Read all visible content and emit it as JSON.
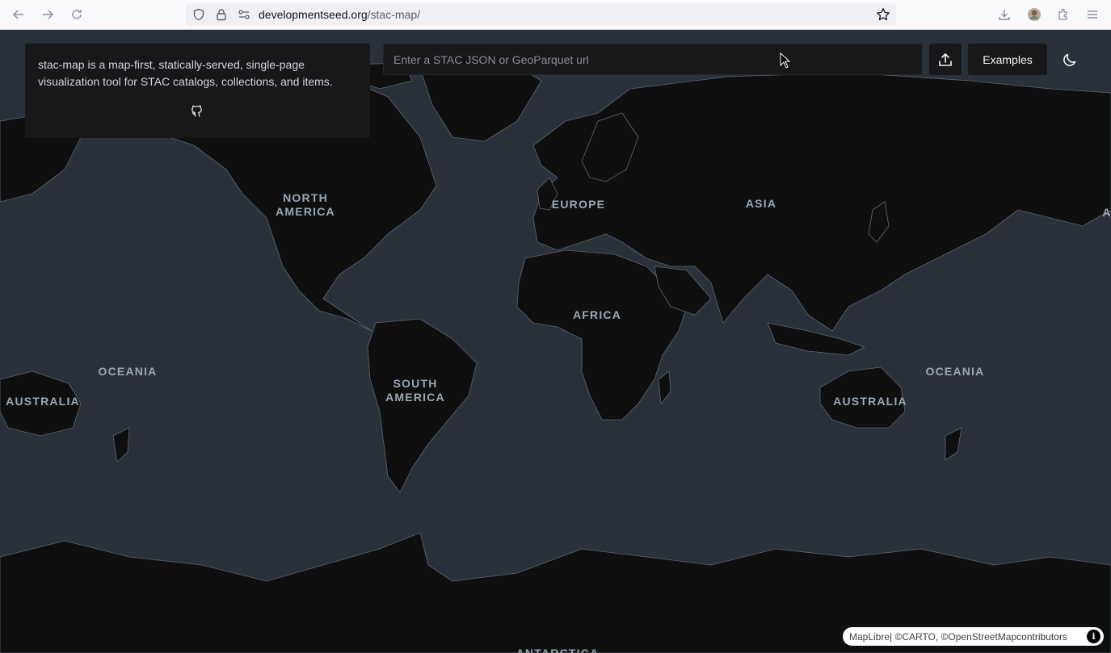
{
  "browser": {
    "url_domain": "developmentseed.org",
    "url_path": "/stac-map/",
    "icons": [
      "back-icon",
      "forward-icon",
      "reload-icon",
      "shield-icon",
      "lock-icon",
      "permissions-icon",
      "bookmark-star-icon",
      "download-icon",
      "profile-avatar-icon",
      "extensions-icon",
      "menu-icon"
    ]
  },
  "info_panel": {
    "description": "stac-map is a map-first, statically-served, single-page visualization tool for STAC catalogs, collections, and items."
  },
  "search": {
    "placeholder": "Enter a STAC JSON or GeoParquet url",
    "value": ""
  },
  "toolbar": {
    "examples_label": "Examples"
  },
  "map": {
    "labels": {
      "north_america": "NORTH AMERICA",
      "europe": "EUROPE",
      "asia": "ASIA",
      "asia_edge": "A",
      "africa": "AFRICA",
      "south_america": "SOUTH AMERICA",
      "oceania_left": "OCEANIA",
      "oceania_right": "OCEANIA",
      "australia_left": "AUSTRALIA",
      "australia_right": "AUSTRALIA",
      "antarctica": "ANTARCTICA"
    },
    "colors": {
      "water": "#2b313a",
      "land": "#0f0f10",
      "borders": "#5c6570"
    }
  },
  "attribution": {
    "maplibre": "MapLibre",
    "separator": " | © ",
    "carto": "CARTO",
    "comma": ", © ",
    "osm": "OpenStreetMap",
    "contributors": " contributors",
    "info_glyph": "i"
  }
}
